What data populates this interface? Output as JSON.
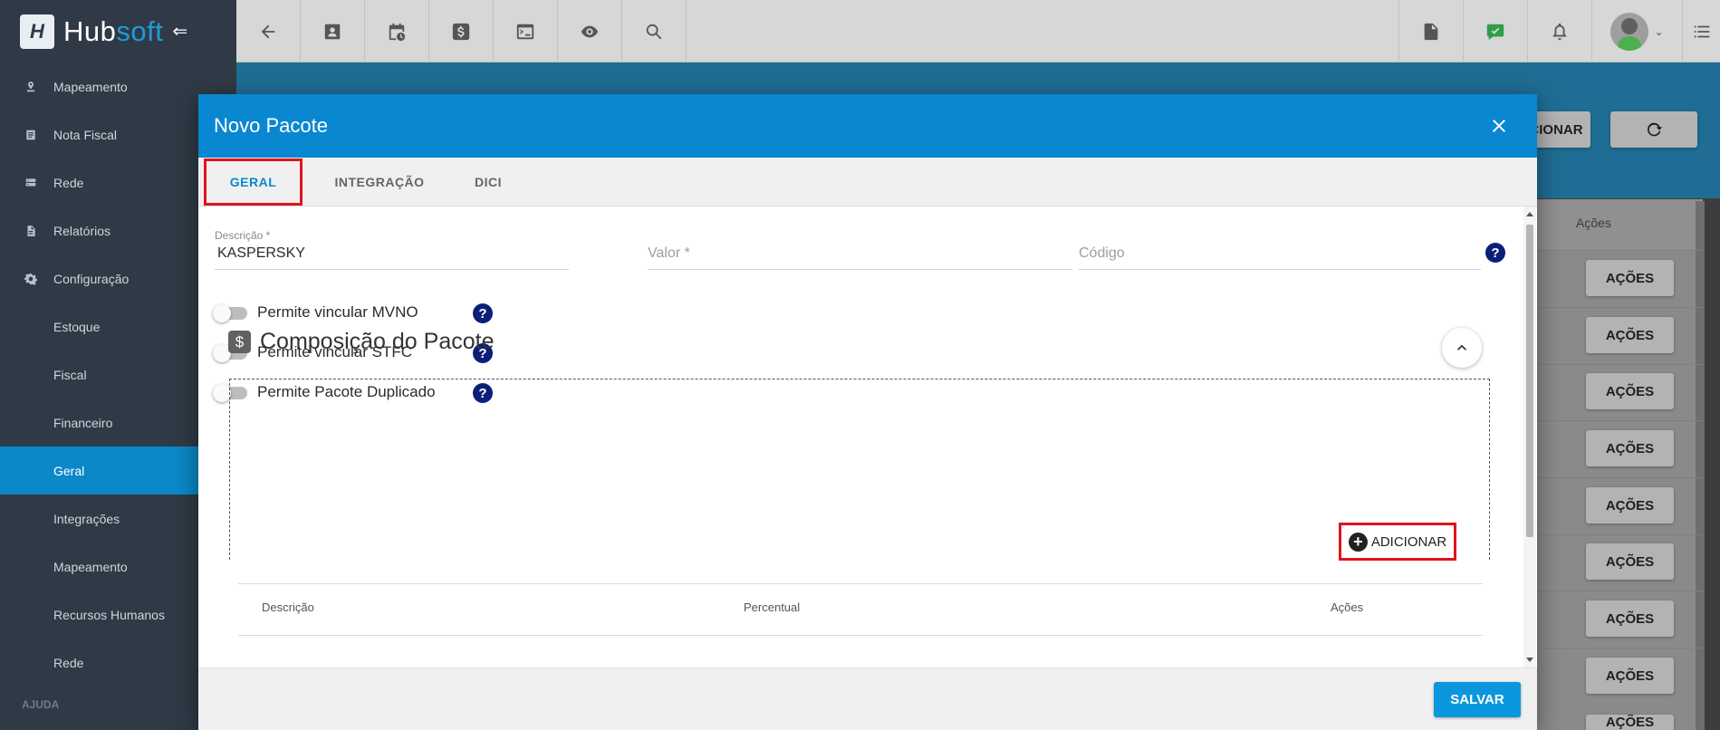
{
  "app": {
    "logo_letter": "H",
    "logo_hub": "Hub",
    "logo_soft": "soft"
  },
  "topbar": {
    "left_icons": [
      "arrow-left-icon",
      "contact-card-icon",
      "calendar-clock-icon",
      "dollar-icon",
      "terminal-icon",
      "eye-icon",
      "search-icon"
    ],
    "right_icons": [
      "pdf-file-icon",
      "checked-message-icon",
      "bell-icon",
      "user-avatar",
      "list-icon"
    ]
  },
  "sidebar": {
    "items": [
      {
        "label": "Mapeamento",
        "icon": "pin-icon",
        "sub": false
      },
      {
        "label": "Nota Fiscal",
        "icon": "receipt-icon",
        "sub": false
      },
      {
        "label": "Rede",
        "icon": "server-icon",
        "sub": false
      },
      {
        "label": "Relatórios",
        "icon": "report-icon",
        "sub": false
      },
      {
        "label": "Configuração",
        "icon": "gear-icon",
        "sub": false
      },
      {
        "label": "Estoque",
        "sub": true
      },
      {
        "label": "Fiscal",
        "sub": true
      },
      {
        "label": "Financeiro",
        "sub": true
      },
      {
        "label": "Geral",
        "sub": true,
        "active": true
      },
      {
        "label": "Integrações",
        "sub": true
      },
      {
        "label": "Mapeamento",
        "sub": true
      },
      {
        "label": "Recursos Humanos",
        "sub": true
      },
      {
        "label": "Rede",
        "sub": true
      }
    ],
    "section_ajuda": "AJUDA"
  },
  "background": {
    "partial_button": "CIONAR",
    "acoes_header": "Ações",
    "acoes_button": "AÇÕES"
  },
  "modal": {
    "title": "Novo Pacote",
    "tabs": [
      "GERAL",
      "INTEGRAÇÃO",
      "DICI"
    ],
    "fields": {
      "descricao_label": "Descrição *",
      "descricao_value": "KASPERSKY",
      "valor_placeholder": "Valor *",
      "codigo_placeholder": "Código"
    },
    "toggles": [
      {
        "label": "Permite vincular MVNO",
        "checked": false
      },
      {
        "label": "Permite vincular STFC",
        "checked": false
      },
      {
        "label": "Permite Pacote Duplicado",
        "checked": false
      }
    ],
    "section": {
      "icon_glyph": "$",
      "title": "Composição do Pacote",
      "add_label": "ADICIONAR",
      "table_headers": [
        "Descrição",
        "Percentual",
        "Ações"
      ]
    },
    "save_label": "SALVAR"
  },
  "colors": {
    "primary": "#0a87d1",
    "sidebar": "#2f3a46",
    "highlight": "#e0141e",
    "help": "#0b1f7a"
  }
}
